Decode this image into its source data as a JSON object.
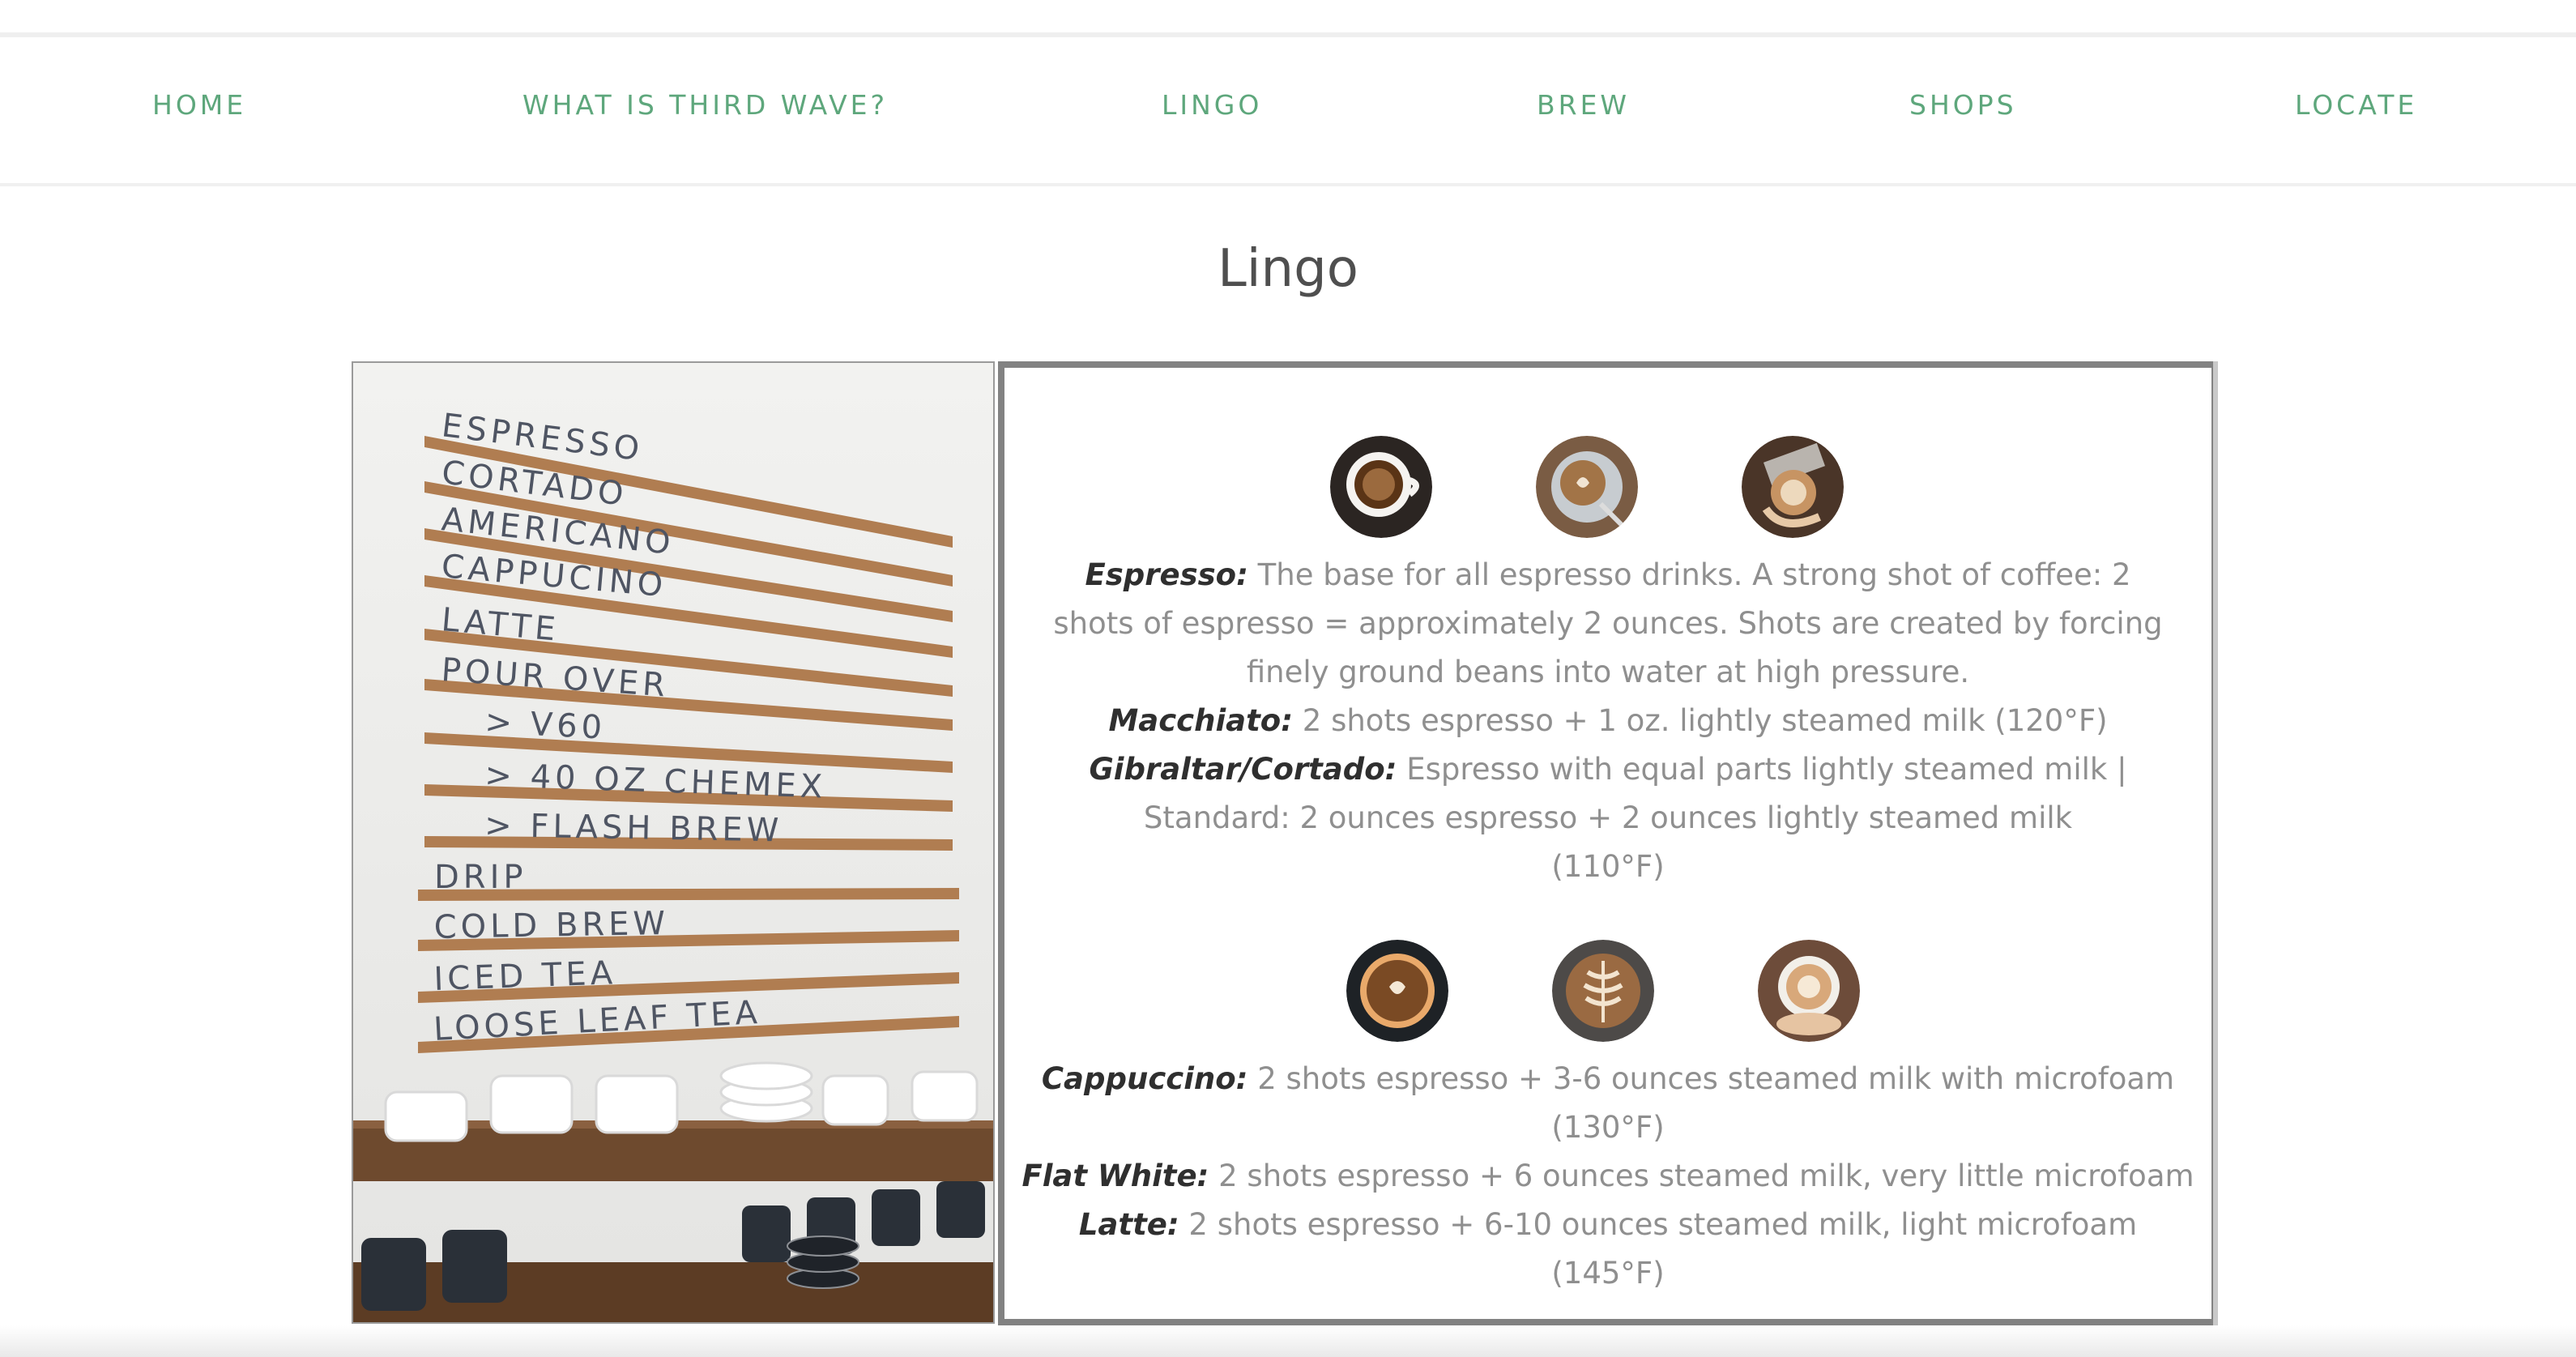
{
  "nav": {
    "items": [
      {
        "label": "HOME"
      },
      {
        "label": "WHAT IS THIRD WAVE?"
      },
      {
        "label": "LINGO"
      },
      {
        "label": "BREW"
      },
      {
        "label": "SHOPS"
      },
      {
        "label": "LOCATE"
      }
    ],
    "color": "#5ea77c"
  },
  "page": {
    "title": "Lingo"
  },
  "menu_board": {
    "items": [
      "ESPRESSO",
      "CORTADO",
      "AMERICANO",
      "CAPPUCINO",
      "LATTE",
      "POUR OVER",
      "> V60",
      "> 40 OZ CHEMEX",
      "> FLASH BREW",
      "DRIP",
      "COLD BREW",
      "ICED TEA",
      "LOOSE LEAF TEA"
    ]
  },
  "drinks": {
    "group1_icons": [
      "espresso-cup-icon",
      "macchiato-cup-icon",
      "cortado-glass-icon"
    ],
    "group1": [
      {
        "name": "Espresso:",
        "desc": " The base for all espresso drinks. A strong shot of coffee: 2 shots of espresso = approximately 2 ounces. Shots are created by forcing finely ground beans into water at high pressure."
      },
      {
        "name": "Macchiato:",
        "desc": " 2 shots espresso + 1 oz. lightly steamed milk (120°F)"
      },
      {
        "name": "Gibraltar/Cortado:",
        "desc": " Espresso with equal parts lightly steamed milk | Standard: 2 ounces espresso + 2 ounces lightly steamed milk",
        "extra": "(110°F)"
      }
    ],
    "group2_icons": [
      "cappuccino-cup-icon",
      "flat-white-cup-icon",
      "latte-cup-icon"
    ],
    "group2": [
      {
        "name": "Cappuccino:",
        "desc": " 2 shots espresso + 3-6 ounces steamed milk with microfoam",
        "extra": "(130°F)"
      },
      {
        "name": "Flat White:",
        "desc": " 2 shots espresso + 6 ounces steamed milk, very little microfoam"
      },
      {
        "name": "Latte:",
        "desc": " 2 shots espresso + 6-10 ounces steamed milk, light microfoam",
        "extra": "(145°F)"
      }
    ]
  }
}
